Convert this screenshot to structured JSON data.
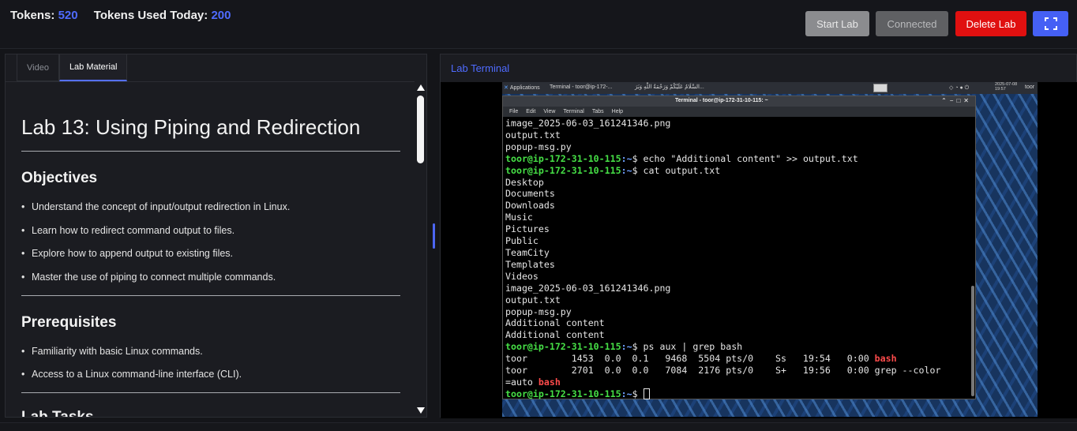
{
  "header": {
    "tokens_label": "Tokens:",
    "tokens_value": "520",
    "used_label": "Tokens Used Today:",
    "used_value": "200",
    "start_lab": "Start Lab",
    "connected": "Connected",
    "delete_lab": "Delete Lab",
    "fullscreen_icon": "fullscreen-icon",
    "colors": {
      "accent": "#4f6bff",
      "danger": "#e01010",
      "primary": "#4560f5"
    }
  },
  "left_panel": {
    "tabs": [
      {
        "label": "Video"
      },
      {
        "label": "Lab Material"
      }
    ],
    "active_tab": "Lab Material",
    "title": "Lab 13: Using Piping and Redirection",
    "objectives_heading": "Objectives",
    "objectives": [
      "Understand the concept of input/output redirection in Linux.",
      "Learn how to redirect command output to files.",
      "Explore how to append output to existing files.",
      "Master the use of piping to connect multiple commands."
    ],
    "prereq_heading": "Prerequisites",
    "prerequisites": [
      "Familiarity with basic Linux commands.",
      "Access to a Linux command-line interface (CLI)."
    ],
    "next_heading": "Lab Tasks"
  },
  "right_panel": {
    "title": "Lab Terminal",
    "desktop": {
      "applications": "Applications",
      "task": "Terminal - toor@ip-172-...",
      "arabic_text": "السَّلَامُ عَلَيْكُمْ وَرَحْمَةُ اللَّهِ وَبَرَ...",
      "clock_date": "2025-07-08",
      "clock_time": "19:57",
      "user": "toor"
    },
    "window": {
      "title": "Terminal - toor@ip-172-31-10-115: ~",
      "menu": [
        "File",
        "Edit",
        "View",
        "Terminal",
        "Tabs",
        "Help"
      ],
      "prompt_user": "toor@ip-172-31-10-115",
      "prompt_suffix": ":~$ ",
      "lines_pre": [
        "image_2025-06-03_161241346.png",
        "output.txt",
        "popup-msg.py"
      ],
      "cmd1": "echo \"Additional content\" >> output.txt",
      "cmd2": "cat output.txt",
      "cat_output": [
        "Desktop",
        "Documents",
        "Downloads",
        "Music",
        "Pictures",
        "Public",
        "TeamCity",
        "Templates",
        "Videos",
        "image_2025-06-03_161241346.png",
        "output.txt",
        "popup-msg.py",
        "Additional content",
        "Additional content"
      ],
      "cmd3": "ps aux | grep bash",
      "ps1_pre": "toor        1453  0.0  0.1   9468  5504 pts/0    Ss   19:54   0:00 ",
      "ps1_hl": "bash",
      "ps2_pre": "toor        2701  0.0  0.0   7084  2176 pts/0    S+   19:56   0:00 grep --color",
      "ps2_cont": "=auto ",
      "ps2_hl": "bash"
    }
  }
}
